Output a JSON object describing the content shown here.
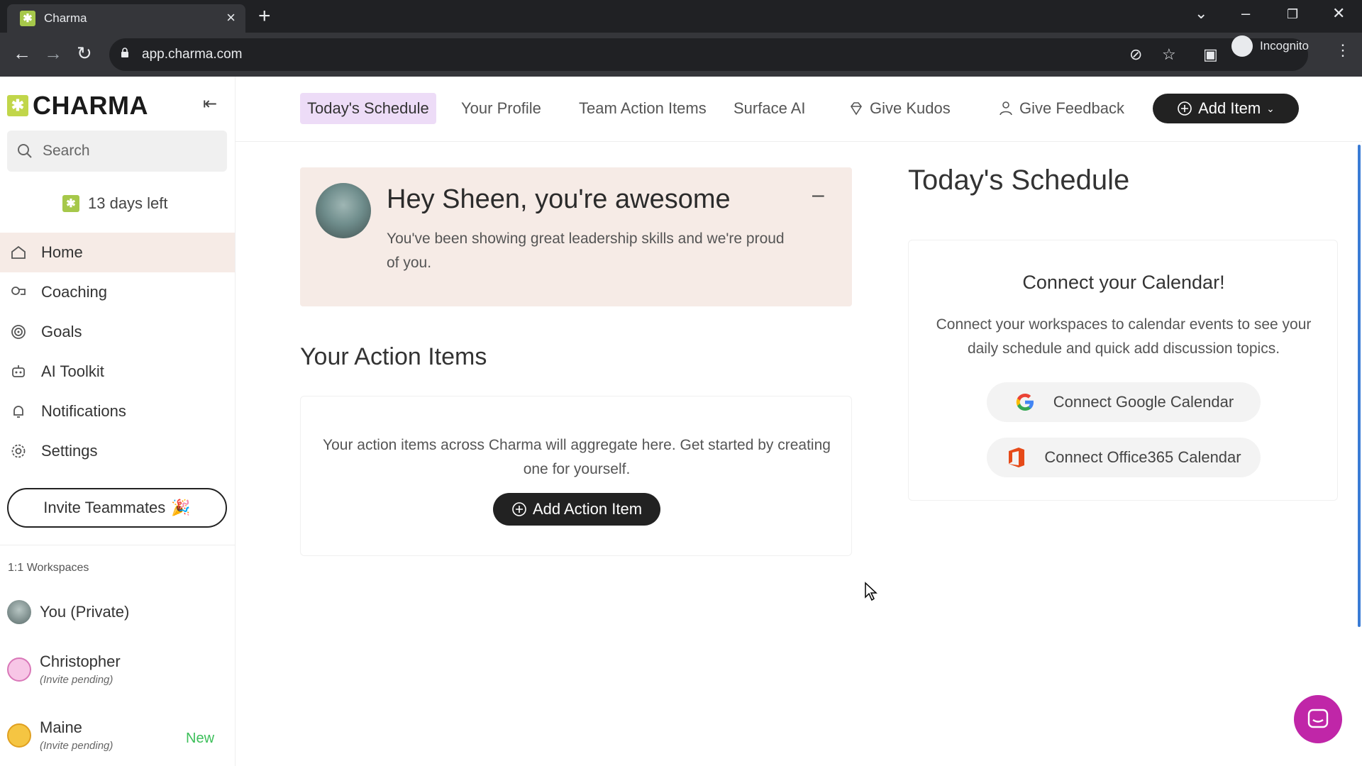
{
  "browser": {
    "tab_title": "Charma",
    "url": "app.charma.com",
    "profile_label": "Incognito"
  },
  "sidebar": {
    "logo_text": "CHARMA",
    "search_placeholder": "Search",
    "trial_text": "13 days left",
    "nav": [
      {
        "label": "Home",
        "icon": "home-icon",
        "active": true
      },
      {
        "label": "Coaching",
        "icon": "coaching-icon"
      },
      {
        "label": "Goals",
        "icon": "target-icon"
      },
      {
        "label": "AI Toolkit",
        "icon": "robot-icon"
      },
      {
        "label": "Notifications",
        "icon": "bell-icon"
      },
      {
        "label": "Settings",
        "icon": "gear-icon"
      }
    ],
    "invite_label": "Invite Teammates",
    "invite_emoji": "🎉",
    "workspaces_label": "1:1 Workspaces",
    "workspaces": [
      {
        "name": "You (Private)",
        "sub": ""
      },
      {
        "name": "Christopher",
        "sub": "(Invite pending)"
      },
      {
        "name": "Maine",
        "sub": "(Invite pending)",
        "badge": "New"
      }
    ]
  },
  "topnav": {
    "items": [
      "Today's Schedule",
      "Your Profile",
      "Team Action Items",
      "Surface AI"
    ],
    "kudos_label": "Give Kudos",
    "feedback_label": "Give Feedback",
    "add_item_label": "Add Item"
  },
  "kudos": {
    "title": "Hey Sheen, you're awesome",
    "body": "You've been showing great leadership skills and we're proud of you.",
    "minimize": "–"
  },
  "action_items": {
    "heading": "Your Action Items",
    "empty_text": "Your action items across Charma will aggregate here. Get started by creating one for yourself.",
    "button_label": "Add Action Item"
  },
  "schedule": {
    "heading": "Today's Schedule",
    "card_title": "Connect your Calendar!",
    "card_desc": "Connect your workspaces to calendar events to see your daily schedule and quick add discussion topics.",
    "google_label": "Connect Google Calendar",
    "office_label": "Connect Office365 Calendar"
  },
  "colors": {
    "accent_purple": "#eddcf7",
    "kudos_bg": "#f6ebe6",
    "brand_green": "#a6c84a",
    "chat_button": "#c026a8",
    "new_badge": "#3dbf5a"
  }
}
